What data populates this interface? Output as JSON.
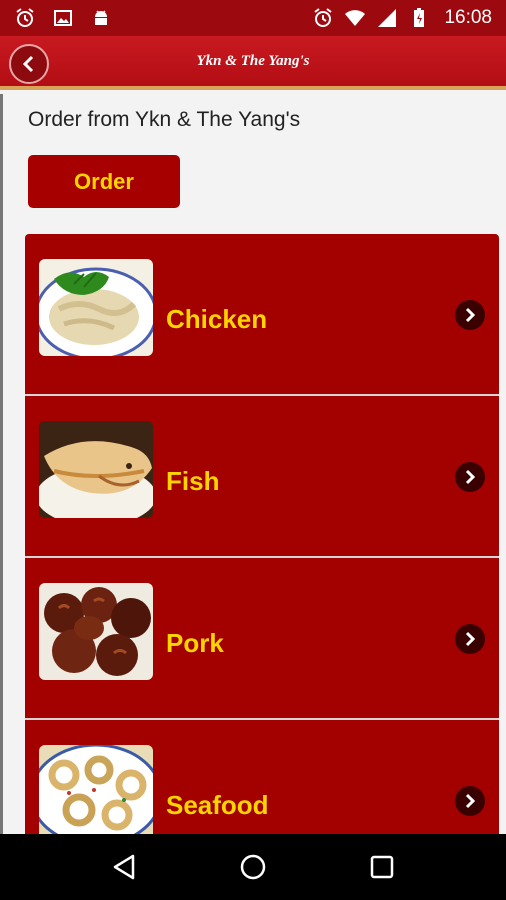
{
  "status_bar": {
    "time": "16:08",
    "icons": [
      "alarm-icon",
      "image-icon",
      "android-icon",
      "alarm-icon",
      "wifi-icon",
      "signal-icon",
      "battery-icon"
    ]
  },
  "app_bar": {
    "title": "Ykn & The Yang's",
    "back_icon": "chevron-left-icon"
  },
  "main": {
    "intro_text": "Order from Ykn & The Yang's",
    "order_button_label": "Order",
    "categories": [
      {
        "label": "Chicken"
      },
      {
        "label": "Fish"
      },
      {
        "label": "Pork"
      },
      {
        "label": "Seafood"
      }
    ]
  },
  "nav_bar": {
    "buttons": [
      "back-icon",
      "home-icon",
      "recents-icon"
    ]
  },
  "colors": {
    "status_bar": "#9c0a10",
    "app_bar": "#c81a20",
    "list_background": "#a30000",
    "label_yellow": "#ffd400"
  }
}
